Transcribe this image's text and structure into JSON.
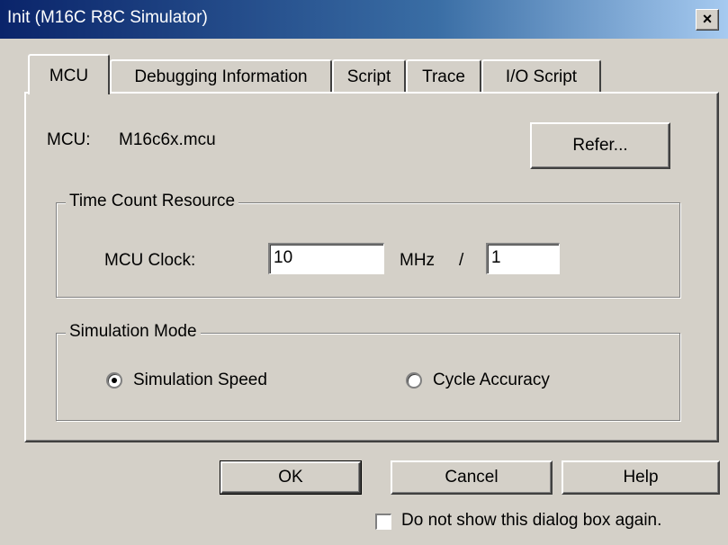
{
  "window": {
    "title": "Init (M16C R8C Simulator)",
    "close_glyph": "×"
  },
  "tabs": [
    {
      "label": "MCU",
      "active": true
    },
    {
      "label": "Debugging Information",
      "active": false
    },
    {
      "label": "Script",
      "active": false
    },
    {
      "label": "Trace",
      "active": false
    },
    {
      "label": "I/O Script",
      "active": false
    }
  ],
  "mcu": {
    "label": "MCU:",
    "value": "M16c6x.mcu",
    "refer_button": "Refer..."
  },
  "time_count": {
    "group_title": "Time Count Resource",
    "clock_label": "MCU Clock:",
    "clock_value": "10",
    "unit": "MHz",
    "separator": "/",
    "divider_value": "1"
  },
  "simulation_mode": {
    "group_title": "Simulation Mode",
    "options": [
      {
        "label": "Simulation Speed",
        "selected": true
      },
      {
        "label": "Cycle Accuracy",
        "selected": false
      }
    ]
  },
  "buttons": {
    "ok": "OK",
    "cancel": "Cancel",
    "help": "Help"
  },
  "footer": {
    "checkbox_label": "Do not show this dialog box again.",
    "checked": false
  }
}
